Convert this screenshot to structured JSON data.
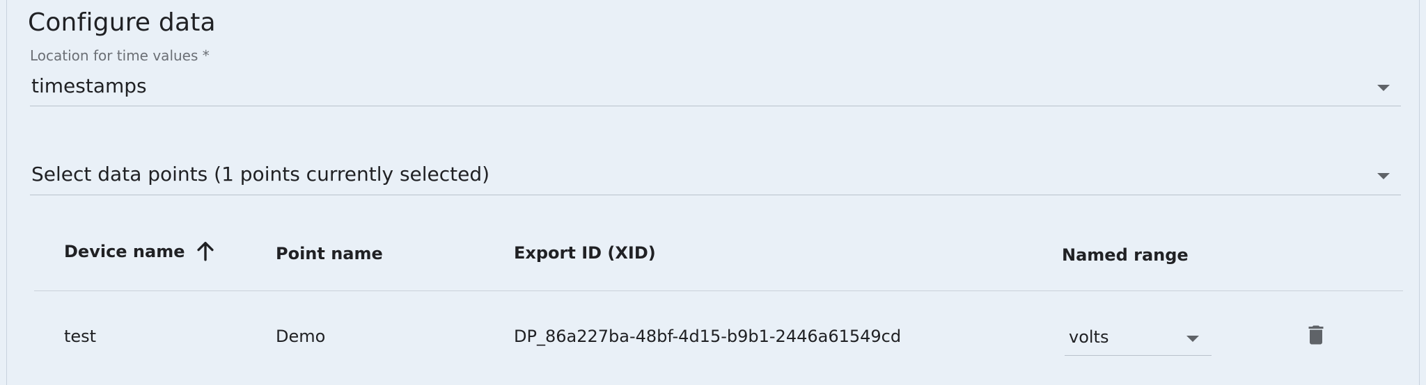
{
  "header": {
    "title": "Configure data"
  },
  "time_location": {
    "label": "Location for time values *",
    "value": "timestamps"
  },
  "data_points": {
    "summary": "Select data points (1 points currently selected)"
  },
  "table": {
    "columns": {
      "device_name": "Device name",
      "point_name": "Point name",
      "export_id": "Export ID (XID)",
      "named_range": "Named range"
    },
    "sort": {
      "column": "device_name",
      "direction": "ascending",
      "icon": "arrow-up-icon"
    },
    "rows": [
      {
        "device_name": "test",
        "point_name": "Demo",
        "export_id": "DP_86a227ba-48bf-4d15-b9b1-2446a61549cd",
        "named_range": "volts"
      }
    ]
  },
  "icons": {
    "dropdown": "chevron-down-icon",
    "delete": "trash-icon"
  },
  "colors": {
    "background": "#e9f0f7",
    "text": "#202124",
    "label": "#6b6f75",
    "icon": "#5f6368"
  }
}
